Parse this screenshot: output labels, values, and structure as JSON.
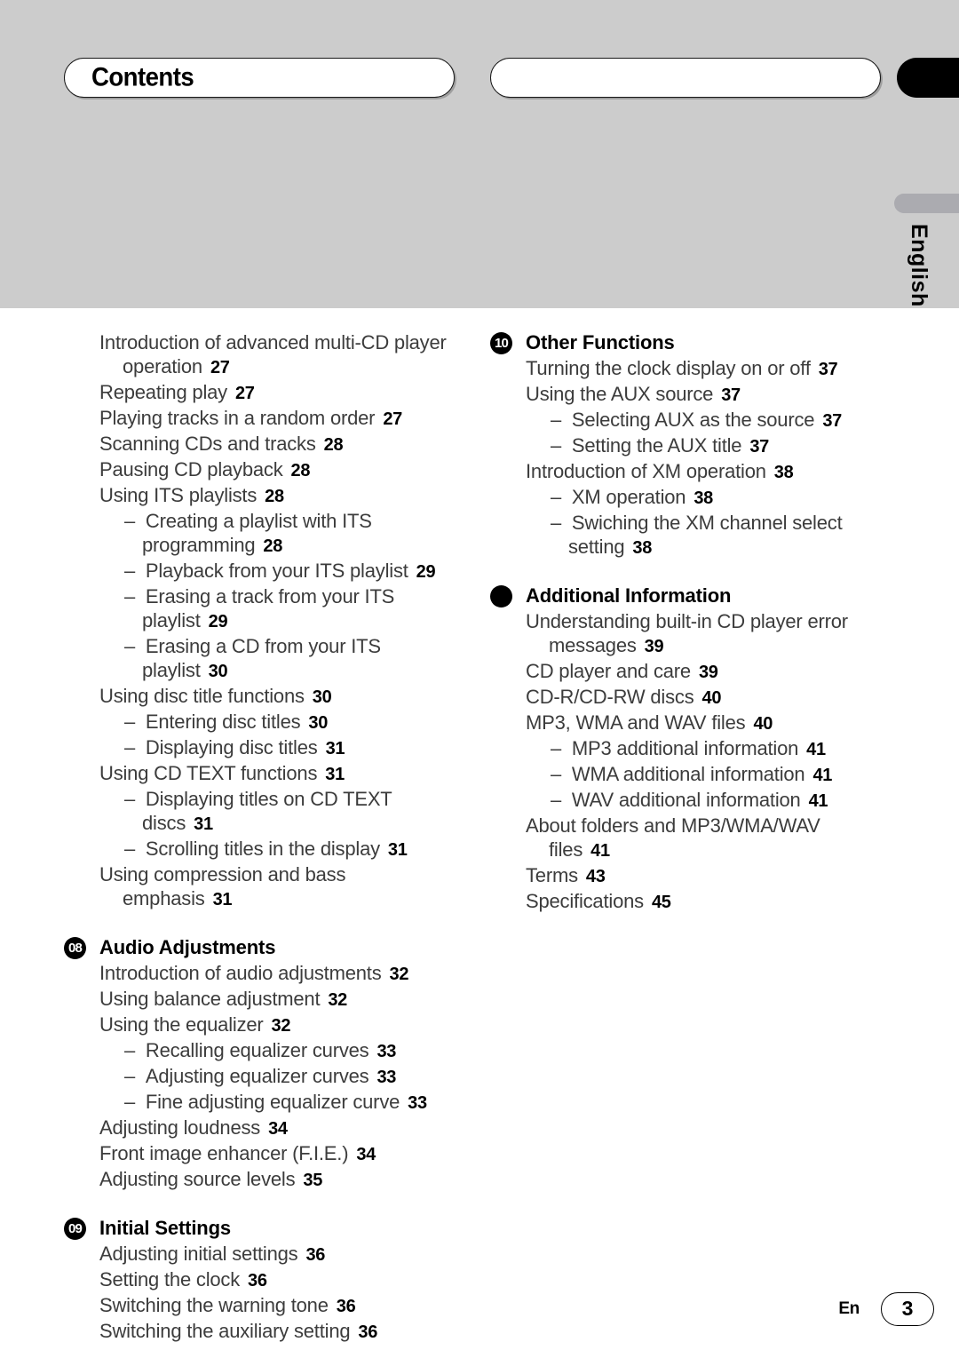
{
  "header": {
    "title": "Contents",
    "right_box_label": "",
    "language_tab": "English"
  },
  "footer": {
    "language_code": "En",
    "page_number": "3"
  },
  "columns": {
    "left": [
      {
        "id": "continued-multicd",
        "badge": null,
        "heading": null,
        "entries": [
          {
            "level": 1,
            "text": "Introduction of advanced multi-CD player operation",
            "page": "27"
          },
          {
            "level": 1,
            "text": "Repeating play",
            "page": "27"
          },
          {
            "level": 1,
            "text": "Playing tracks in a random order",
            "page": "27"
          },
          {
            "level": 1,
            "text": "Scanning CDs and tracks",
            "page": "28"
          },
          {
            "level": 1,
            "text": "Pausing CD playback",
            "page": "28"
          },
          {
            "level": 1,
            "text": "Using ITS playlists",
            "page": "28"
          },
          {
            "level": 2,
            "text": "Creating a playlist with ITS programming",
            "page": "28"
          },
          {
            "level": 2,
            "text": "Playback from your ITS playlist",
            "page": "29"
          },
          {
            "level": 2,
            "text": "Erasing a track from your ITS playlist",
            "page": "29"
          },
          {
            "level": 2,
            "text": "Erasing a CD from your ITS playlist",
            "page": "30"
          },
          {
            "level": 1,
            "text": "Using disc title functions",
            "page": "30"
          },
          {
            "level": 2,
            "text": "Entering disc titles",
            "page": "30"
          },
          {
            "level": 2,
            "text": "Displaying disc titles",
            "page": "31"
          },
          {
            "level": 1,
            "text": "Using CD TEXT functions",
            "page": "31"
          },
          {
            "level": 2,
            "text": "Displaying titles on CD TEXT discs",
            "page": "31"
          },
          {
            "level": 2,
            "text": "Scrolling titles in the display",
            "page": "31"
          },
          {
            "level": 1,
            "text": "Using compression and bass emphasis",
            "page": "31"
          }
        ]
      },
      {
        "id": "audio-adjustments",
        "badge": "08",
        "heading": "Audio Adjustments",
        "entries": [
          {
            "level": 1,
            "text": "Introduction of audio adjustments",
            "page": "32"
          },
          {
            "level": 1,
            "text": "Using balance adjustment",
            "page": "32"
          },
          {
            "level": 1,
            "text": "Using the equalizer",
            "page": "32"
          },
          {
            "level": 2,
            "text": "Recalling equalizer curves",
            "page": "33"
          },
          {
            "level": 2,
            "text": "Adjusting equalizer curves",
            "page": "33"
          },
          {
            "level": 2,
            "text": "Fine adjusting equalizer curve",
            "page": "33"
          },
          {
            "level": 1,
            "text": "Adjusting loudness",
            "page": "34"
          },
          {
            "level": 1,
            "text": "Front image enhancer (F.I.E.)",
            "page": "34"
          },
          {
            "level": 1,
            "text": "Adjusting source levels",
            "page": "35"
          }
        ]
      },
      {
        "id": "initial-settings",
        "badge": "09",
        "heading": "Initial Settings",
        "entries": [
          {
            "level": 1,
            "text": "Adjusting initial settings",
            "page": "36"
          },
          {
            "level": 1,
            "text": "Setting the clock",
            "page": "36"
          },
          {
            "level": 1,
            "text": "Switching the warning tone",
            "page": "36"
          },
          {
            "level": 1,
            "text": "Switching the auxiliary setting",
            "page": "36"
          }
        ]
      }
    ],
    "right": [
      {
        "id": "other-functions",
        "badge": "10",
        "heading": "Other Functions",
        "entries": [
          {
            "level": 1,
            "text": "Turning the clock display on or off",
            "page": "37"
          },
          {
            "level": 1,
            "text": "Using the AUX source",
            "page": "37"
          },
          {
            "level": 2,
            "text": "Selecting AUX as the source",
            "page": "37"
          },
          {
            "level": 2,
            "text": "Setting the AUX title",
            "page": "37"
          },
          {
            "level": 1,
            "text": "Introduction of XM operation",
            "page": "38"
          },
          {
            "level": 2,
            "text": "XM operation",
            "page": "38"
          },
          {
            "level": 2,
            "text": "Swiching the XM channel select setting",
            "page": "38"
          }
        ]
      },
      {
        "id": "additional-information",
        "badge": "",
        "heading": "Additional Information",
        "entries": [
          {
            "level": 1,
            "text": "Understanding built-in CD player error messages",
            "page": "39"
          },
          {
            "level": 1,
            "text": "CD player and care",
            "page": "39"
          },
          {
            "level": 1,
            "text": "CD-R/CD-RW discs",
            "page": "40"
          },
          {
            "level": 1,
            "text": "MP3, WMA and WAV files",
            "page": "40"
          },
          {
            "level": 2,
            "text": "MP3 additional information",
            "page": "41"
          },
          {
            "level": 2,
            "text": "WMA additional information",
            "page": "41"
          },
          {
            "level": 2,
            "text": "WAV additional information",
            "page": "41"
          },
          {
            "level": 1,
            "text": "About folders and MP3/WMA/WAV files",
            "page": "41"
          },
          {
            "level": 1,
            "text": "Terms",
            "page": "43"
          },
          {
            "level": 1,
            "text": "Specifications",
            "page": "45"
          }
        ]
      }
    ]
  },
  "icons": {
    "dash": "–"
  }
}
